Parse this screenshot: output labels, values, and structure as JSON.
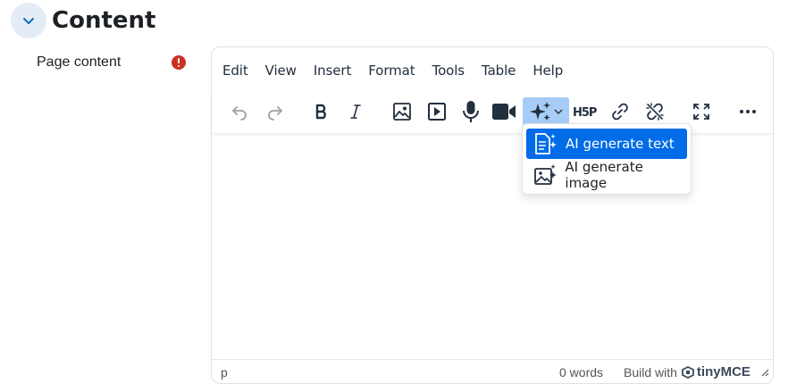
{
  "section": {
    "title": "Content"
  },
  "field": {
    "label": "Page content"
  },
  "menubar": {
    "items": [
      "Edit",
      "View",
      "Insert",
      "Format",
      "Tools",
      "Table",
      "Help"
    ]
  },
  "toolbar": {
    "buttons": [
      "undo-icon",
      "redo-icon",
      "bold-icon",
      "italic-icon",
      "image-icon",
      "media-icon",
      "microphone-icon",
      "video-camera-icon",
      "ai-sparkles-icon",
      "h5p-icon",
      "link-icon",
      "unlink-icon",
      "fullscreen-icon",
      "more-icon"
    ],
    "h5p_label": "H5P"
  },
  "ai_menu": {
    "items": [
      {
        "label": "AI generate text",
        "icon": "ai-text-icon"
      },
      {
        "label": "AI generate image",
        "icon": "ai-image-icon"
      }
    ]
  },
  "statusbar": {
    "path": "p",
    "word_count": "0 words",
    "built_with": "Build with",
    "brand": "tinyMCE"
  },
  "colors": {
    "accent": "#006ce7",
    "active_bg": "#a6ccf7",
    "required": "#ca3120"
  }
}
